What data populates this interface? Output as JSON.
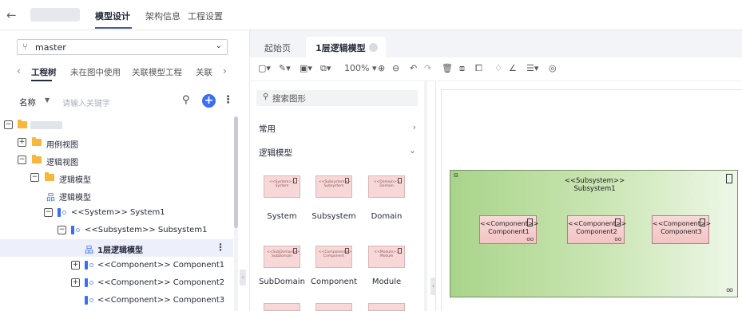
{
  "topbar": {
    "back_icon": "arrow-left-icon",
    "tabs": [
      {
        "label": "模型设计",
        "active": true
      },
      {
        "label": "架构信息",
        "active": false
      },
      {
        "label": "工程设置",
        "active": false
      }
    ]
  },
  "left": {
    "branch": "master",
    "subtabs": [
      "工程树",
      "未在图中使用",
      "关联模型工程",
      "关联"
    ],
    "filter": {
      "label": "名称",
      "placeholder": "请输入关键字"
    },
    "tree": [
      {
        "label": "用例视图"
      },
      {
        "label": "逻辑视图"
      },
      {
        "label": "逻辑模型"
      },
      {
        "label": "逻辑模型"
      },
      {
        "label": "<<System>> System1"
      },
      {
        "label": "<<Subsystem>> Subsystem1"
      },
      {
        "label": "1层逻辑模型"
      },
      {
        "label": "<<Component>> Component1"
      },
      {
        "label": "<<Component>> Component2"
      },
      {
        "label": "<<Component>> Component3"
      }
    ]
  },
  "editor": {
    "doc_tabs": [
      {
        "label": "起始页",
        "active": false
      },
      {
        "label": "1层逻辑模型",
        "active": true
      }
    ],
    "toolbar": {
      "zoom": "100%"
    },
    "shape_panel": {
      "search_placeholder": "搜索图形",
      "categories": [
        "常用",
        "逻辑模型"
      ],
      "shapes": [
        {
          "label": "System",
          "tile_text": "<<System>> System"
        },
        {
          "label": "Subsystem",
          "tile_text": "<<Subsystem>> Subsystem"
        },
        {
          "label": "Domain",
          "tile_text": "<<Domain>> Domain"
        },
        {
          "label": "SubDomain",
          "tile_text": "<<SubDomain>> SubDomain"
        },
        {
          "label": "Component",
          "tile_text": "<<Component>> Component"
        },
        {
          "label": "Module",
          "tile_text": "<<Module>> Module"
        }
      ]
    },
    "diagram": {
      "subsystem_stereotype": "<<Subsystem>>",
      "subsystem_name": "Subsystem1",
      "components": [
        {
          "stereotype": "<<Component>>",
          "name": "Component1"
        },
        {
          "stereotype": "<<Component>>",
          "name": "Component2"
        },
        {
          "stereotype": "<<Component>>",
          "name": "Component3"
        }
      ]
    }
  },
  "colors": {
    "accent": "#3b6ef5",
    "subsystem_fill": "#a9d48a",
    "component_fill": "#f7d7d7",
    "folder": "#f6b73c"
  }
}
